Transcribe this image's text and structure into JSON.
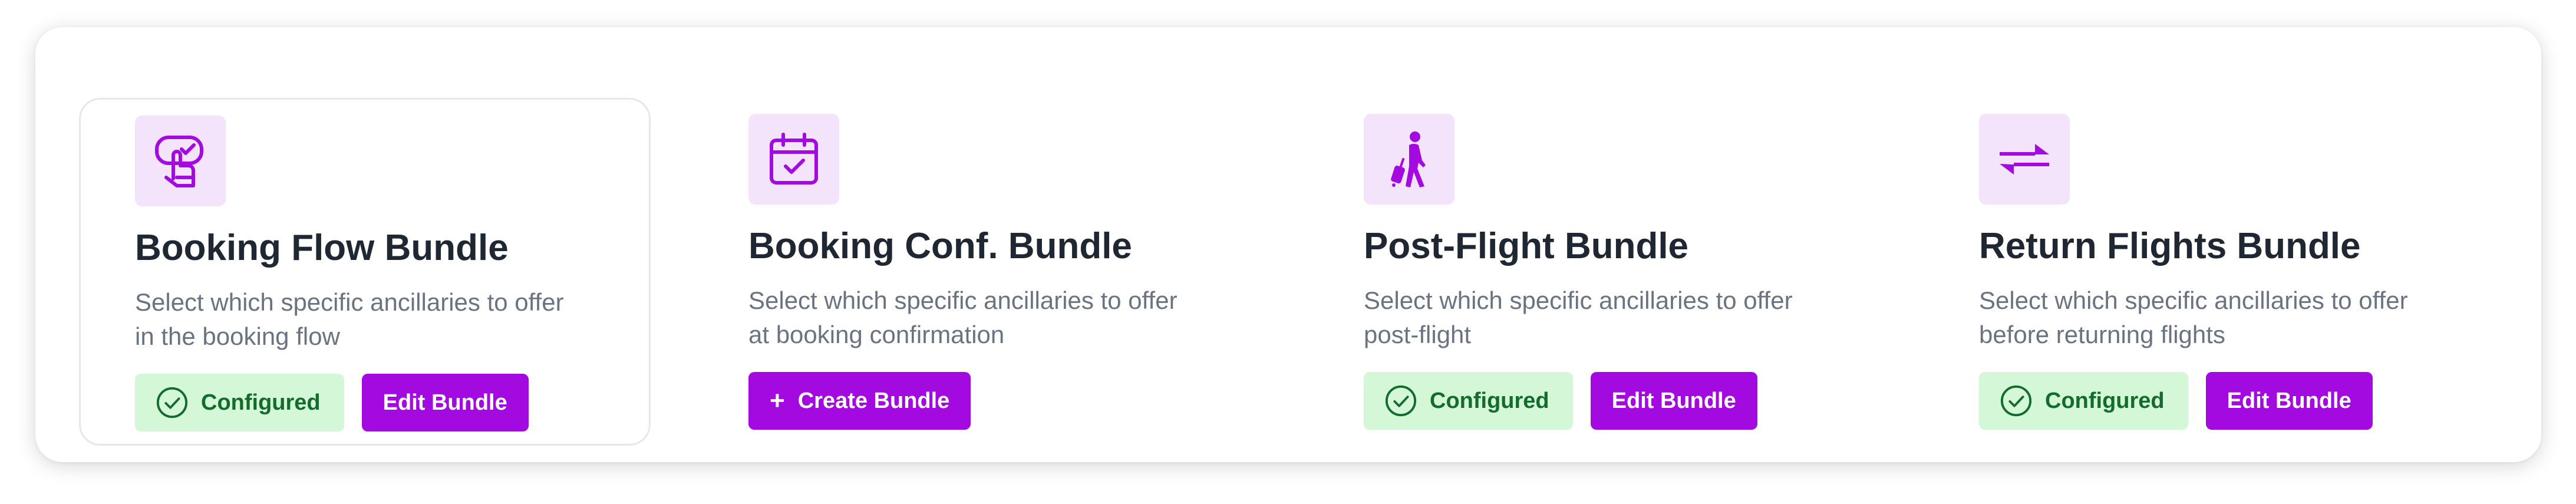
{
  "colors": {
    "accent": "#a20ae0",
    "icon_tile_bg": "#f4e4fb",
    "configured_bg": "#d4f8d7",
    "configured_text": "#136b2c",
    "title_text": "#1f2733",
    "desc_text": "#6a7382"
  },
  "cards": [
    {
      "icon": "touch-screen-icon",
      "title": "Booking Flow Bundle",
      "description": "Select which specific ancillaries to offer in the booking flow",
      "status_label": "Configured",
      "action_label": "Edit Bundle"
    },
    {
      "icon": "calendar-check-icon",
      "title": "Booking Conf. Bundle",
      "description": "Select which specific ancillaries to offer at booking confirmation",
      "action_label": "Create Bundle"
    },
    {
      "icon": "traveler-luggage-icon",
      "title": "Post-Flight Bundle",
      "description": "Select which specific ancillaries to offer post-flight",
      "status_label": "Configured",
      "action_label": "Edit Bundle"
    },
    {
      "icon": "swap-arrows-icon",
      "title": "Return Flights Bundle",
      "description": "Select which specific ancillaries to offer before returning flights",
      "status_label": "Configured",
      "action_label": "Edit Bundle"
    }
  ]
}
